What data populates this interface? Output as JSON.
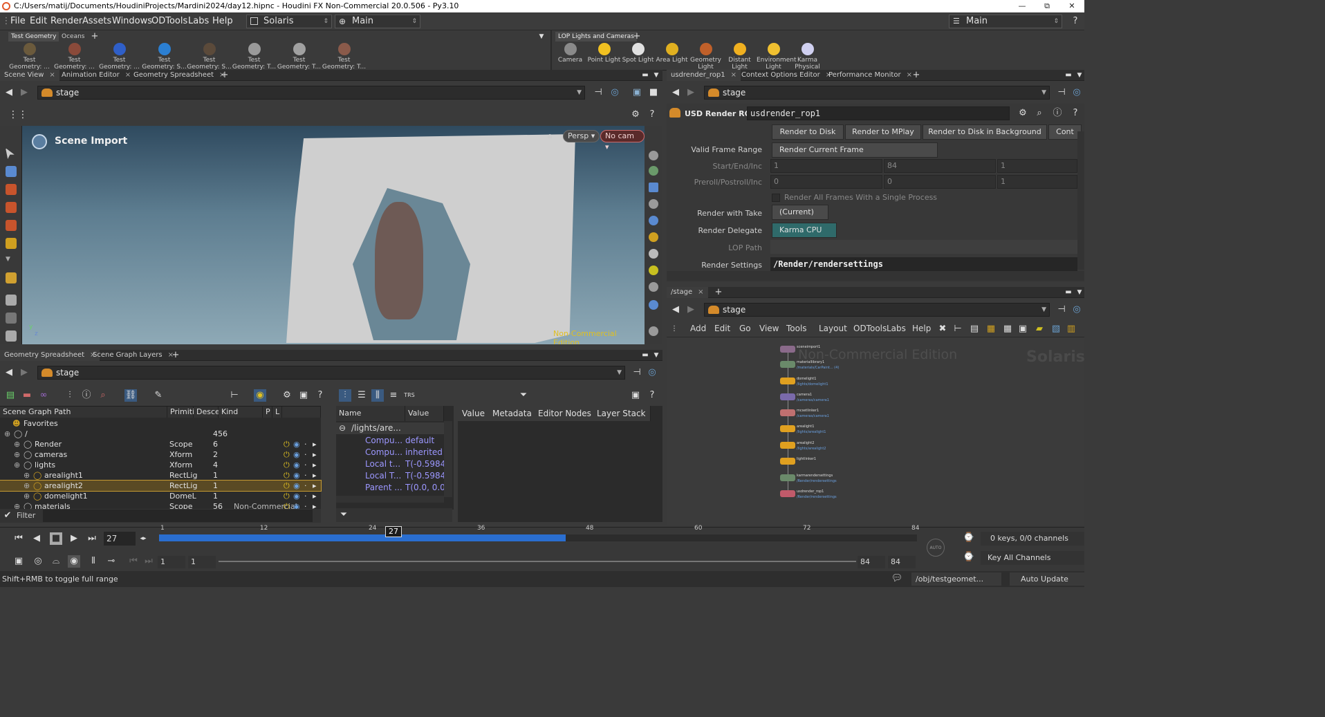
{
  "titlebar": {
    "title": "C:/Users/matij/Documents/HoudiniProjects/Mardini2024/day12.hipnc - Houdini FX Non-Commercial 20.0.506 - Py3.10",
    "minimize": "—",
    "maximize": "⧉",
    "close": "✕"
  },
  "menu": {
    "items": [
      "File",
      "Edit",
      "Render",
      "Assets",
      "Windows",
      "ODTools",
      "Labs",
      "Help"
    ],
    "desktop": "Solaris",
    "workspace": "Main",
    "right_workspace": "Main"
  },
  "shelf_left": {
    "tabs": [
      "Test Geometry",
      "Oceans"
    ],
    "tools": [
      {
        "l1": "Test",
        "l2": "Geometry: ...",
        "icon": "squab-icon",
        "color": "#6b5a3c"
      },
      {
        "l1": "Test",
        "l2": "Geometry: ...",
        "icon": "crag-icon",
        "color": "#8a4a3a"
      },
      {
        "l1": "Test",
        "l2": "Geometry: ...",
        "icon": "shaderball-icon",
        "color": "#2f5fc8"
      },
      {
        "l1": "Test",
        "l2": "Geometry: S...",
        "icon": "sphere-icon",
        "color": "#2b7fd2"
      },
      {
        "l1": "Test",
        "l2": "Geometry: S...",
        "icon": "spider-icon",
        "color": "#5b4a3a"
      },
      {
        "l1": "Test",
        "l2": "Geometry: T...",
        "icon": "tommy-icon",
        "color": "#9a9a9a"
      },
      {
        "l1": "Test",
        "l2": "Geometry: T...",
        "icon": "head-icon",
        "color": "#a0a0a0"
      },
      {
        "l1": "Test",
        "l2": "Geometry: T...",
        "icon": "figure-icon",
        "color": "#8a5a4a"
      }
    ]
  },
  "shelf_right": {
    "tabs": [
      "LOP Lights and Cameras"
    ],
    "tools": [
      {
        "l1": "Camera",
        "l2": "",
        "icon": "camera-icon",
        "color": "#8a8a8a"
      },
      {
        "l1": "Point Light",
        "l2": "",
        "icon": "point-light-icon",
        "color": "#f0c020"
      },
      {
        "l1": "Spot Light",
        "l2": "",
        "icon": "spot-light-icon",
        "color": "#e0e0e0"
      },
      {
        "l1": "Area Light",
        "l2": "",
        "icon": "area-light-icon",
        "color": "#e0b020"
      },
      {
        "l1": "Geometry",
        "l2": "Light",
        "icon": "geometry-light-icon",
        "color": "#c0602a"
      },
      {
        "l1": "Distant Light",
        "l2": "",
        "icon": "distant-light-icon",
        "color": "#f0b020"
      },
      {
        "l1": "Environment",
        "l2": "Light",
        "icon": "env-light-icon",
        "color": "#f0c030"
      },
      {
        "l1": "Karma",
        "l2": "Physical Sk...",
        "icon": "karma-sky-icon",
        "color": "#d0d0f0"
      }
    ]
  },
  "scene_tabs": [
    "Scene View",
    "Animation Editor",
    "Geometry Spreadsheet"
  ],
  "context_path": "stage",
  "viewport": {
    "label": "Scene Import",
    "persp": "Persp",
    "cam": "No cam",
    "watermark": "Non-Commercial Edition",
    "axis_y": "y",
    "axis_z": "z"
  },
  "sgt_tabs": [
    "Geometry Spreadsheet",
    "Scene Graph Layers"
  ],
  "scene_graph": {
    "columns": [
      "Scene Graph Path",
      "Primiti",
      "Desce",
      "Kind",
      "P",
      "L"
    ],
    "favorites": "Favorites",
    "rows": [
      {
        "name": "/",
        "type": "",
        "count": "456",
        "kind": "",
        "indent": 0
      },
      {
        "name": "Render",
        "type": "Scope",
        "count": "6",
        "kind": "",
        "indent": 1
      },
      {
        "name": "cameras",
        "type": "Xform",
        "count": "2",
        "kind": "",
        "indent": 1
      },
      {
        "name": "lights",
        "type": "Xform",
        "count": "4",
        "kind": "",
        "indent": 1
      },
      {
        "name": "arealight1",
        "type": "RectLig",
        "count": "1",
        "kind": "",
        "indent": 2
      },
      {
        "name": "arealight2",
        "type": "RectLig",
        "count": "1",
        "kind": "",
        "indent": 2,
        "selected": true
      },
      {
        "name": "domelight1",
        "type": "DomeL",
        "count": "1",
        "kind": "",
        "indent": 2
      },
      {
        "name": "materials",
        "type": "Scope",
        "count": "56",
        "kind": "Non-Commercial Edition",
        "indent": 1
      }
    ],
    "filter_label": "Filter"
  },
  "attributes": {
    "columns": [
      "Name",
      "Value"
    ],
    "group": "/lights/are...",
    "rows": [
      {
        "name": "Compu...",
        "value": "default"
      },
      {
        "name": "Compu...",
        "value": "inherited"
      },
      {
        "name": "Local t...",
        "value": "T(-0.5984,"
      },
      {
        "name": "Local T...",
        "value": "T(-0.5984,"
      },
      {
        "name": "Parent ...",
        "value": "T(0.0, 0.0,"
      }
    ]
  },
  "value_tabs": [
    "Value",
    "Metadata",
    "Editor Nodes",
    "Layer Stack"
  ],
  "param_tabs": [
    "usdrender_rop1",
    "Context Options Editor",
    "Performance Monitor"
  ],
  "params": {
    "node_type": "USD Render ROP",
    "node_name": "usdrender_rop1",
    "buttons": [
      "Render to Disk",
      "Render to MPlay",
      "Render to Disk in Background",
      "Cont"
    ],
    "valid_frame_range_label": "Valid Frame Range",
    "valid_frame_range": "Render Current Frame",
    "start_end_inc_label": "Start/End/Inc",
    "start_end_inc": [
      "1",
      "84",
      "1"
    ],
    "preroll_label": "Preroll/Postroll/Inc",
    "preroll": [
      "0",
      "0",
      "1"
    ],
    "single_process": "Render All Frames With a Single Process",
    "take_label": "Render with Take",
    "take": "(Current)",
    "delegate_label": "Render Delegate",
    "delegate": "Karma CPU",
    "lop_path_label": "LOP Path",
    "render_settings_label": "Render Settings",
    "render_settings": "/Render/rendersettings"
  },
  "network_tabs": [
    "/stage"
  ],
  "network_menu": [
    "Add",
    "Edit",
    "Go",
    "View",
    "Tools",
    "Layout",
    "ODTools",
    "Labs",
    "Help"
  ],
  "network": {
    "watermark": "Non-Commercial Edition",
    "context_label": "Solaris",
    "nodes": [
      {
        "name": "sceneimport1",
        "sub": "",
        "color": "#8a6a8a"
      },
      {
        "name": "materiallibrary1",
        "sub": "/materials/CarPaint... (4)",
        "color": "#6a8a6a"
      },
      {
        "name": "domelight1",
        "sub": "/lights/domelight1",
        "color": "#e0a020"
      },
      {
        "name": "camera1",
        "sub": "/cameras/camera1",
        "color": "#7a6aaa"
      },
      {
        "name": "mcsetlinker1",
        "sub": "/cameras/camera1",
        "color": "#c07070"
      },
      {
        "name": "arealight1",
        "sub": "/lights/arealight1",
        "color": "#e0a020"
      },
      {
        "name": "arealight2",
        "sub": "/lights/arealight2",
        "color": "#e0a020"
      },
      {
        "name": "lightlinker1",
        "sub": "",
        "color": "#e0a020"
      },
      {
        "name": "karmarendersettings",
        "sub": "/Render/rendersettings",
        "color": "#6a8a6a"
      },
      {
        "name": "usdrender_rop1",
        "sub": "/Render/rendersettings",
        "color": "#c05a6a"
      }
    ]
  },
  "timeline": {
    "current_frame": "27",
    "marker": "27",
    "ticks": [
      "1",
      "12",
      "24",
      "36",
      "48",
      "60",
      "72",
      "84"
    ],
    "start": "1",
    "start2": "1",
    "end": "84",
    "end2": "84",
    "keys_info": "0 keys, 0/0 channels",
    "key_all": "Key All Channels",
    "auto": "AUTO"
  },
  "status": {
    "message": "Shift+RMB to toggle full range",
    "path": "/obj/testgeomet...",
    "update": "Auto Update"
  }
}
